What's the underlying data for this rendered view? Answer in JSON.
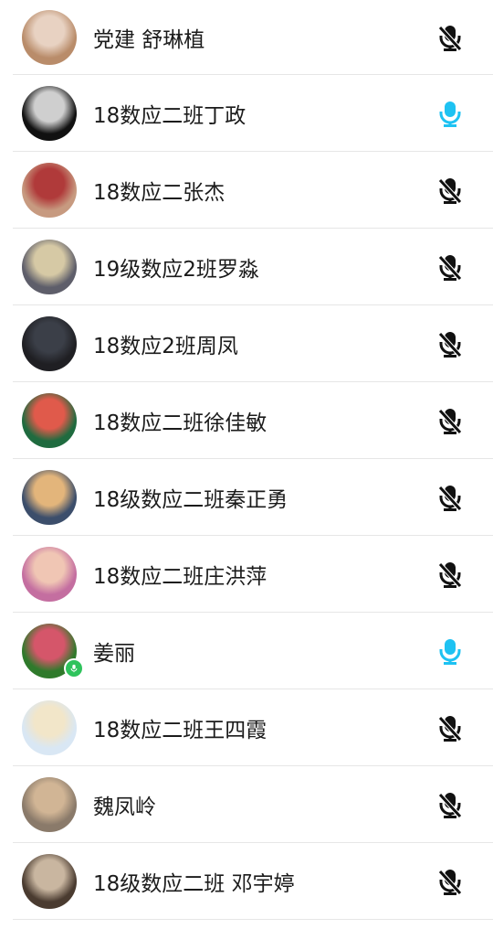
{
  "members": [
    {
      "name": "党建 舒琳植",
      "mic": "muted",
      "avatar_colors": [
        "#b98c6a",
        "#e8d2c2"
      ]
    },
    {
      "name": "18数应二班丁政",
      "mic": "active",
      "avatar_colors": [
        "#111111",
        "#cfcfcf"
      ]
    },
    {
      "name": "18数应二张杰",
      "mic": "muted",
      "avatar_colors": [
        "#c79a80",
        "#b03a3a"
      ]
    },
    {
      "name": "19级数应2班罗淼",
      "mic": "muted",
      "avatar_colors": [
        "#5e5e6a",
        "#d6c9a5"
      ]
    },
    {
      "name": "18数应2班周凤",
      "mic": "muted",
      "avatar_colors": [
        "#1f1f23",
        "#3b3f48"
      ]
    },
    {
      "name": "18数应二班徐佳敏",
      "mic": "muted",
      "avatar_colors": [
        "#1f6b3f",
        "#e05a4b"
      ]
    },
    {
      "name": "18级数应二班秦正勇",
      "mic": "muted",
      "avatar_colors": [
        "#3c4e6b",
        "#e3b57b"
      ]
    },
    {
      "name": "18数应二班庄洪萍",
      "mic": "muted",
      "avatar_colors": [
        "#c46ea0",
        "#f0c6b4"
      ]
    },
    {
      "name": "姜丽",
      "mic": "active",
      "avatar_colors": [
        "#2f7a2b",
        "#d5566a"
      ],
      "speaking_badge": true
    },
    {
      "name": "18数应二班王四霞",
      "mic": "muted",
      "avatar_colors": [
        "#d9e7f4",
        "#f2e6c9"
      ]
    },
    {
      "name": "魏凤岭",
      "mic": "muted",
      "avatar_colors": [
        "#8a7a6a",
        "#d1b595"
      ]
    },
    {
      "name": "18级数应二班 邓宇婷",
      "mic": "muted",
      "avatar_colors": [
        "#4a3b30",
        "#c9b6a0"
      ]
    }
  ],
  "colors": {
    "mic_muted": "#111111",
    "mic_active": "#1ec2f2",
    "badge": "#2fc35c"
  },
  "icons": {
    "muted": "mic-off-icon",
    "active": "mic-icon"
  }
}
